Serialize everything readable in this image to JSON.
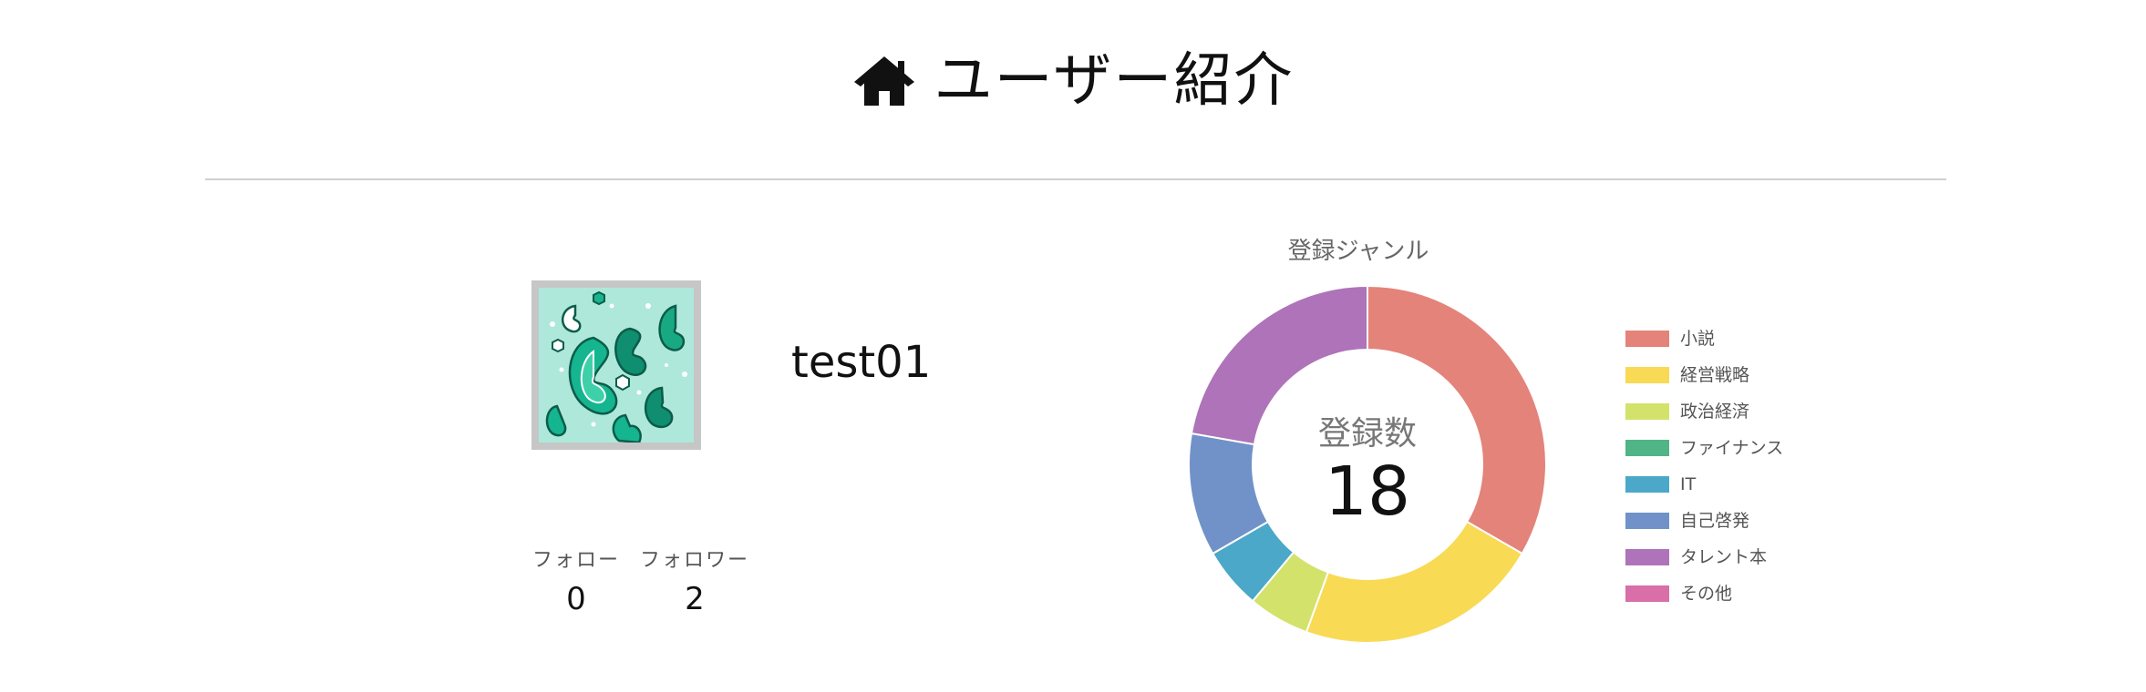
{
  "header": {
    "title": "ユーザー紹介",
    "icon": "home-icon"
  },
  "profile": {
    "username": "test01",
    "avatar_icon": "paisley-pattern-avatar",
    "follow_label": "フォロー",
    "follow_count": "0",
    "follower_label": "フォロワー",
    "follower_count": "2"
  },
  "chart_data": {
    "type": "pie",
    "title": "登録ジャンル",
    "center_label": "登録数",
    "center_value": "18",
    "categories": [
      "小説",
      "経営戦略",
      "政治経済",
      "ファイナンス",
      "IT",
      "自己啓発",
      "タレント本",
      "その他"
    ],
    "values": [
      6,
      4,
      1,
      0,
      1,
      2,
      4,
      0
    ],
    "colors": [
      "#e3837a",
      "#f8da55",
      "#d3e26a",
      "#50b486",
      "#4ba8c8",
      "#7092c8",
      "#ae73b8",
      "#d86fa8"
    ],
    "legend_position": "right"
  }
}
